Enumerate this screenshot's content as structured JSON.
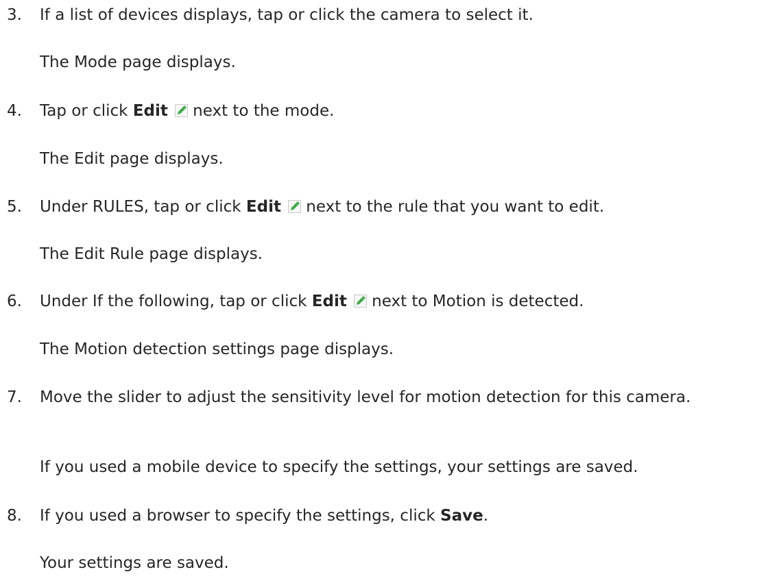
{
  "steps": [
    {
      "number": "3.",
      "text": "If a list of devices displays, tap or click the camera to select it.",
      "result": "The Mode page displays."
    },
    {
      "number": "4.",
      "text_before": "Tap or click",
      "bold": "Edit",
      "text_after": "next to the mode.",
      "icon": "edit-pencil-icon",
      "result": "The Edit page displays."
    },
    {
      "number": "5.",
      "text_before": "Under RULES, tap or click",
      "bold": "Edit",
      "text_after": "next to the rule that you want to edit.",
      "icon": "edit-pencil-icon",
      "result": "The Edit Rule page displays."
    },
    {
      "number": "6.",
      "text_before": "Under If the following, tap or click",
      "bold": "Edit",
      "text_after": "next to Motion is detected.",
      "icon": "edit-pencil-icon",
      "result": "The Motion detection settings page displays."
    },
    {
      "number": "7.",
      "text": "Move the slider to adjust the sensitivity level for motion detection for this camera.",
      "result": "If you used a mobile device to specify the settings, your settings are saved."
    },
    {
      "number": "8.",
      "text_before": "If you used a browser to specify the settings, click",
      "bold": "Save",
      "text_after": ".",
      "result": "Your settings are saved."
    }
  ],
  "colors": {
    "text": "#262626",
    "icon_green": "#3fae49",
    "icon_border": "#c9c9c9"
  }
}
